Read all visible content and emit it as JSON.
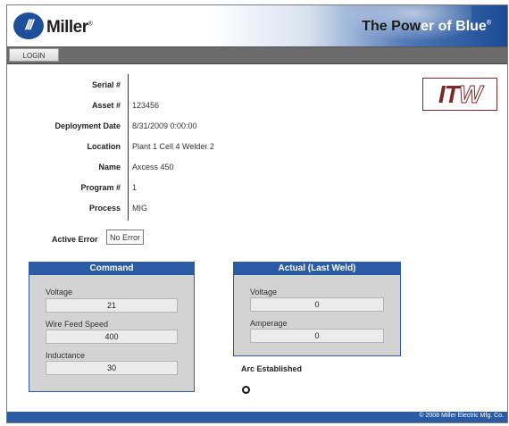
{
  "header": {
    "brand": "Miller",
    "brand_mark": "///",
    "tagline_dark": "The Pow",
    "tagline_light": "er of Blue",
    "trademark": "®"
  },
  "menu": {
    "login_label": "LOGIN"
  },
  "info": [
    {
      "label": "Serial #",
      "value": ""
    },
    {
      "label": "Asset #",
      "value": "123456"
    },
    {
      "label": "Deployment Date",
      "value": "8/31/2009 0:00:00"
    },
    {
      "label": "Location",
      "value": "Plant 1 Cell 4 Welder 2"
    },
    {
      "label": "Name",
      "value": "Axcess 450"
    },
    {
      "label": "Program #",
      "value": "1"
    },
    {
      "label": "Process",
      "value": "MIG"
    }
  ],
  "itw_logo": {
    "text_solid": "IT",
    "text_outline": "W"
  },
  "active_error": {
    "label": "Active Error",
    "value": "No Error"
  },
  "command": {
    "title": "Command",
    "fields": [
      {
        "label": "Voltage",
        "value": "21"
      },
      {
        "label": "Wire Feed Speed",
        "value": "400"
      },
      {
        "label": "Inductance",
        "value": "30"
      }
    ]
  },
  "actual": {
    "title": "Actual (Last Weld)",
    "fields": [
      {
        "label": "Voltage",
        "value": "0"
      },
      {
        "label": "Amperage",
        "value": "0"
      }
    ],
    "arc_label": "Arc Established"
  },
  "footer": {
    "copyright": "© 2008 Miller Electric Mfg. Co."
  },
  "colors": {
    "accent": "#2c5ba5",
    "panel_bg": "#d3d3d3",
    "itw": "#7a2b2b"
  }
}
